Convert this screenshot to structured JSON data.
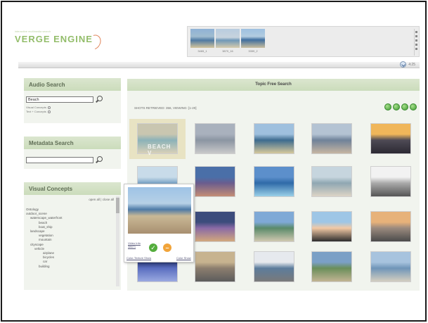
{
  "app": {
    "tagline": "interactive multimedia search",
    "name": "VERGE ENGINE"
  },
  "shot_strip": {
    "shots": [
      {
        "label": "3465_1"
      },
      {
        "label": "3870_16"
      },
      {
        "label": "3359_2"
      }
    ]
  },
  "zoom": {
    "label": "4:25"
  },
  "audio_search": {
    "title": "Audio Search",
    "query": "Beach",
    "options": [
      "Visual Concepts",
      "Text + Concepts"
    ]
  },
  "metadata_search": {
    "title": "Metadata Search",
    "query": ""
  },
  "visual_concepts": {
    "title": "Visual Concepts",
    "open_all": "open all",
    "close_all": "close all",
    "separator": "|",
    "tree": [
      {
        "label": "Ontology",
        "level": 0
      },
      {
        "label": "outdoor_scene",
        "level": 0
      },
      {
        "label": "waterscape_waterfront",
        "level": 1
      },
      {
        "label": "beach",
        "level": 3
      },
      {
        "label": "boat_ship",
        "level": 3
      },
      {
        "label": "landscape",
        "level": 1
      },
      {
        "label": "vegetation",
        "level": 3
      },
      {
        "label": "mountain",
        "level": 3
      },
      {
        "label": "cityscape",
        "level": 1
      },
      {
        "label": "vehicle",
        "level": 2
      },
      {
        "label": "airplane",
        "level": 4
      },
      {
        "label": "bicycles",
        "level": 4
      },
      {
        "label": "car",
        "level": 4
      },
      {
        "label": "building",
        "level": 3
      }
    ]
  },
  "main": {
    "title": "Topic Free Search",
    "retrieved": "SHOTS RETRIEVED: 356, VIEWING: [1-20]",
    "nav_buttons": [
      "first",
      "previous",
      "next",
      "last"
    ]
  },
  "results": {
    "thumbs": [
      {
        "palette": [
          "#c9c6b0",
          "#8bb2b8",
          "#d8d0b8"
        ],
        "caption": "BEACH V"
      },
      {
        "palette": [
          "#a9b1bd",
          "#8b95a2",
          "#c9c9c9"
        ]
      },
      {
        "palette": [
          "#9fc0de",
          "#3d6b8f",
          "#d6c89b"
        ]
      },
      {
        "palette": [
          "#b4c3d3",
          "#6f8299",
          "#c6b6a2"
        ]
      },
      {
        "palette": [
          "#f0b65a",
          "#4e4a55",
          "#2c2a33"
        ]
      },
      {
        "palette": [
          "#c8dbe9",
          "#7ba4c6",
          "#ffffff"
        ]
      },
      {
        "palette": [
          "#4a6fa8",
          "#6a5d8e",
          "#c48d75"
        ]
      },
      {
        "palette": [
          "#5c8fcb",
          "#2f6aa8",
          "#9ad0e8"
        ]
      },
      {
        "palette": [
          "#c6d5de",
          "#8fa7b2",
          "#dcd4c6"
        ]
      },
      {
        "palette": [
          "#f2f2f2",
          "#aaaaaa",
          "#555555"
        ]
      },
      {
        "palette": [
          "#6f8fbf",
          "#4b3f3f",
          "#e3b38a"
        ]
      },
      {
        "palette": [
          "#3c4c7c",
          "#8a6aa6",
          "#d2a87c"
        ]
      },
      {
        "palette": [
          "#7fa9d6",
          "#5a8a6a",
          "#d0c8b0"
        ]
      },
      {
        "palette": [
          "#9ec6e6",
          "#f2c9a5",
          "#2d2d2d"
        ]
      },
      {
        "palette": [
          "#e7b27a",
          "#9b8a7e",
          "#4b4b4b"
        ]
      },
      {
        "palette": [
          "#2c3c7a",
          "#5a6ec0",
          "#9aa9e0"
        ]
      },
      {
        "palette": [
          "#c7b38f",
          "#8c7e6e",
          "#5c5c5c"
        ]
      },
      {
        "palette": [
          "#e6e9ee",
          "#5c7c9c",
          "#7a7a7a"
        ]
      },
      {
        "palette": [
          "#7ba0c6",
          "#6a8e5a",
          "#c2b494"
        ]
      },
      {
        "palette": [
          "#a7c3de",
          "#6f95b8",
          "#d4cfc0"
        ]
      }
    ]
  },
  "popup": {
    "video_link": "Video Info",
    "shot_id": "38671",
    "color_texture": "Color-Texture Show",
    "color_show": "Color Show"
  },
  "colors": {
    "panel_header": "#cbdcbb",
    "panel_bg": "#f1f4ee",
    "brand_green": "#93bd6a",
    "accept": "#54ad3d",
    "reject": "#f1a43a"
  }
}
